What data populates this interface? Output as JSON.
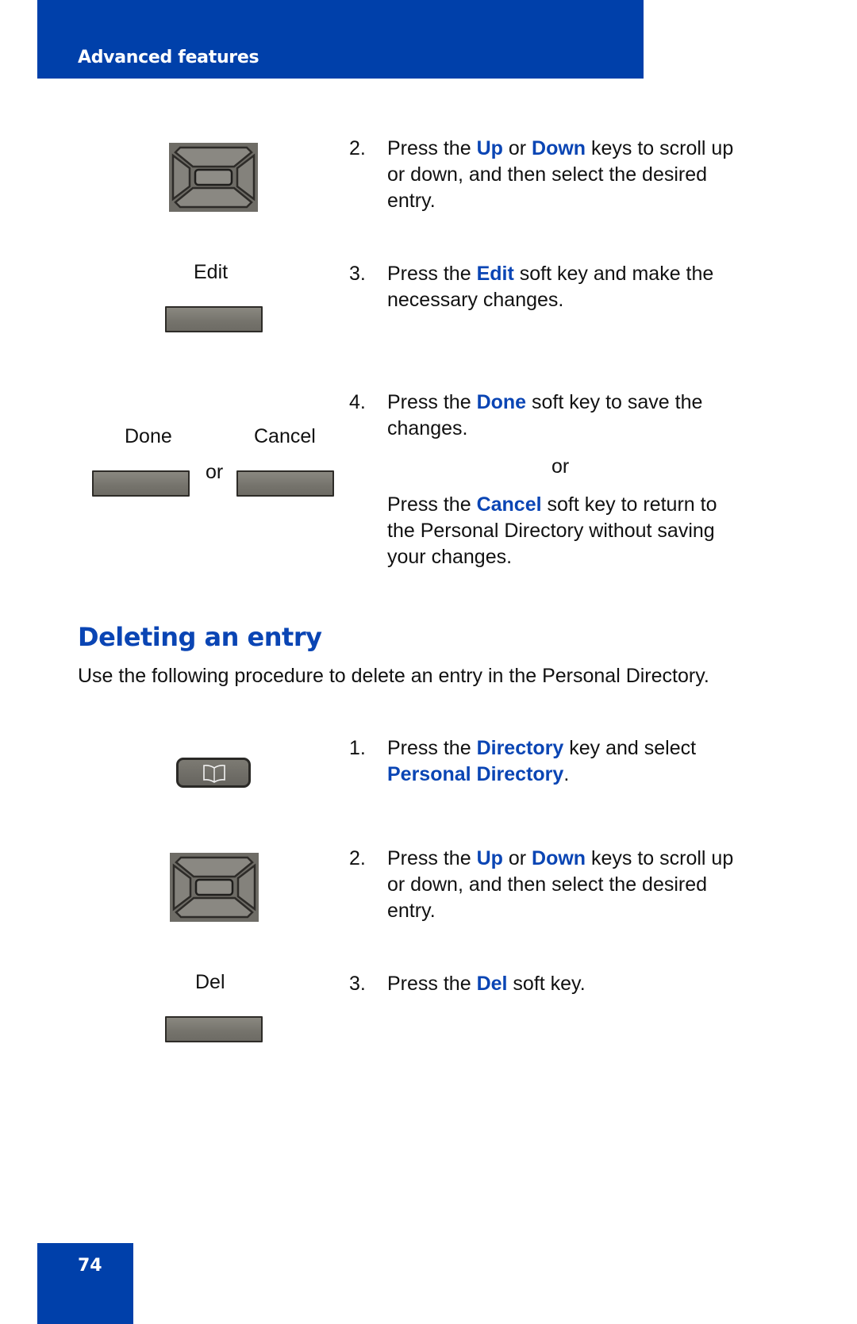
{
  "header": {
    "title": "Advanced features"
  },
  "page_number": "74",
  "upper_steps": [
    {
      "number": "2.",
      "parts": [
        "Press the ",
        "Up",
        " or ",
        "Down",
        " keys to scroll up"
      ],
      "lines": [
        "or down, and then select the desired",
        "entry."
      ],
      "key_icon": "navigation-cluster-icon"
    },
    {
      "number": "3.",
      "parts": [
        "Press the ",
        "Edit",
        " soft key and make the"
      ],
      "lines": [
        "necessary changes."
      ],
      "key_label": "Edit"
    },
    {
      "number": "4.",
      "parts": [
        "Press the ",
        "Done",
        " soft key to save the"
      ],
      "lines": [
        "changes."
      ],
      "or_text": "or",
      "alt_parts": [
        "Press the ",
        "Cancel",
        " soft key to return to"
      ],
      "alt_lines": [
        "the Personal Directory without saving",
        "your changes."
      ],
      "key_labels": {
        "done": "Done",
        "cancel": "Cancel",
        "or": "or"
      }
    }
  ],
  "section": {
    "title": "Deleting an entry",
    "intro": "Use the following procedure to delete an entry in the Personal Directory."
  },
  "lower_steps": [
    {
      "number": "1.",
      "parts": [
        "Press the ",
        "Directory",
        " key and select"
      ],
      "line2_bold": "Personal Directory",
      "line2_tail": ".",
      "key_icon": "directory-book-icon"
    },
    {
      "number": "2.",
      "parts": [
        "Press the ",
        "Up",
        " or ",
        "Down",
        " keys to scroll up"
      ],
      "lines": [
        "or down, and then select the desired",
        "entry."
      ],
      "key_icon": "navigation-cluster-icon"
    },
    {
      "number": "3.",
      "parts": [
        "Press the ",
        "Del",
        " soft key."
      ],
      "key_label": "Del"
    }
  ],
  "colors": {
    "brand_blue": "#0040aa",
    "keyword_blue": "#0a45b4",
    "softkey_gray": "#77756e"
  }
}
